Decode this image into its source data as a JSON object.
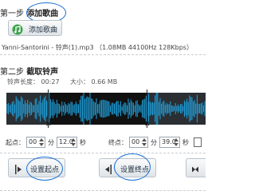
{
  "step1": {
    "prefix": "第一步",
    "title": "添加歌曲",
    "add_button_label": "添加歌曲",
    "file_info": "Yanni-Santorini - 铃声(1).mp3 （1.08MB 44100Hz 128Kbps）"
  },
  "step2": {
    "prefix": "第二步",
    "title": "截取铃声",
    "ringtone_length_label": "铃声长度：",
    "ringtone_length_value": "00:27",
    "size_label": "大小：",
    "size_value": "0.66 MB"
  },
  "start": {
    "label": "起点：",
    "minutes": "00",
    "minutes_unit": "分",
    "seconds": "12.0",
    "seconds_unit": "秒"
  },
  "end": {
    "label": "终点：",
    "minutes": "00",
    "minutes_unit": "分",
    "seconds": "39.0",
    "seconds_unit": "秒"
  },
  "buttons": {
    "set_start": "设置起点",
    "set_end": "设置终点"
  },
  "colors": {
    "waveform": "#1fa3e0",
    "annotation": "#1a6fd6"
  }
}
